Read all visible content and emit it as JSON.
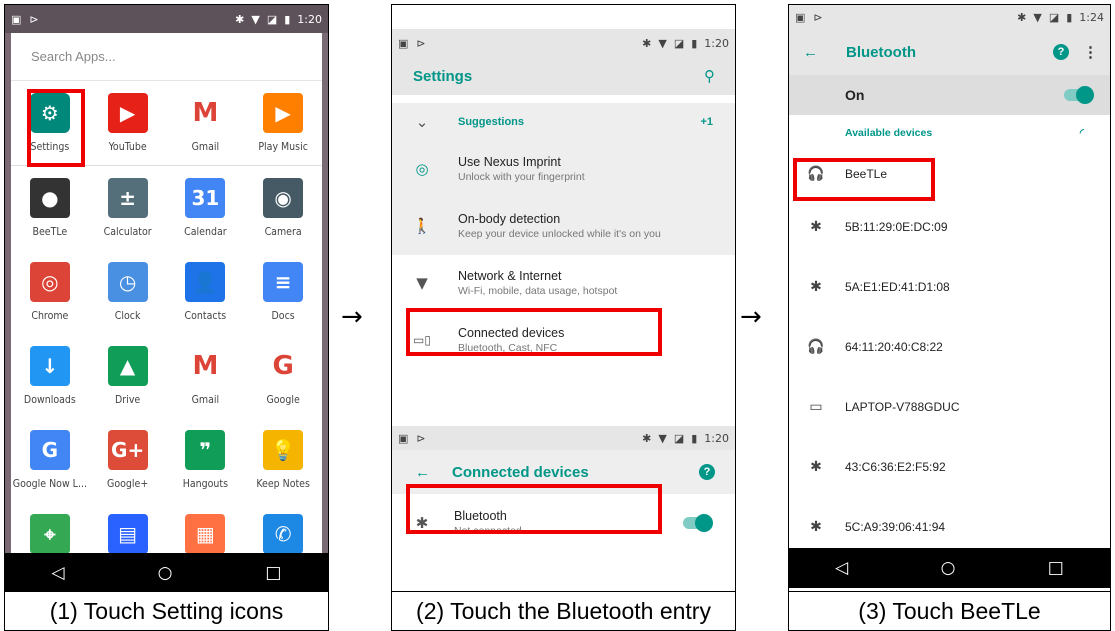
{
  "panel1": {
    "status_time": "1:20",
    "search_placeholder": "Search Apps...",
    "apps": [
      {
        "label": "Settings",
        "icon": "settings-icon",
        "glyph": "⚙",
        "color": "#00897b"
      },
      {
        "label": "YouTube",
        "icon": "youtube-icon",
        "glyph": "▶",
        "color": "#e62117"
      },
      {
        "label": "Gmail",
        "icon": "gmail-icon",
        "glyph": "M",
        "color": "#ffffff"
      },
      {
        "label": "Play Music",
        "icon": "play-music-icon",
        "glyph": "▶",
        "color": "#ff7f00"
      },
      {
        "label": "BeeTLe",
        "icon": "beetle-icon",
        "glyph": "●",
        "color": "#333333"
      },
      {
        "label": "Calculator",
        "icon": "calculator-icon",
        "glyph": "±",
        "color": "#546e7a"
      },
      {
        "label": "Calendar",
        "icon": "calendar-icon",
        "glyph": "31",
        "color": "#4285f4"
      },
      {
        "label": "Camera",
        "icon": "camera-icon",
        "glyph": "◉",
        "color": "#455a64"
      },
      {
        "label": "Chrome",
        "icon": "chrome-icon",
        "glyph": "◎",
        "color": "#db4437"
      },
      {
        "label": "Clock",
        "icon": "clock-icon",
        "glyph": "◷",
        "color": "#4a90e2"
      },
      {
        "label": "Contacts",
        "icon": "contacts-icon",
        "glyph": "👤",
        "color": "#1e73e8"
      },
      {
        "label": "Docs",
        "icon": "docs-icon",
        "glyph": "≡",
        "color": "#4285f4"
      },
      {
        "label": "Downloads",
        "icon": "downloads-icon",
        "glyph": "↓",
        "color": "#2196f3"
      },
      {
        "label": "Drive",
        "icon": "drive-icon",
        "glyph": "▲",
        "color": "#0f9d58"
      },
      {
        "label": "Gmail",
        "icon": "gmail-icon",
        "glyph": "M",
        "color": "#ffffff"
      },
      {
        "label": "Google",
        "icon": "google-icon",
        "glyph": "G",
        "color": "#ffffff"
      },
      {
        "label": "Google Now L...",
        "icon": "google-now-launcher-icon",
        "glyph": "G",
        "color": "#4285f4"
      },
      {
        "label": "Google+",
        "icon": "google-plus-icon",
        "glyph": "G+",
        "color": "#dd4b39"
      },
      {
        "label": "Hangouts",
        "icon": "hangouts-icon",
        "glyph": "❞",
        "color": "#0f9d58"
      },
      {
        "label": "Keep Notes",
        "icon": "keep-notes-icon",
        "glyph": "💡",
        "color": "#f4b400"
      },
      {
        "label": "",
        "icon": "maps-icon",
        "glyph": "⌖",
        "color": "#34a853"
      },
      {
        "label": "",
        "icon": "messages-icon",
        "glyph": "▤",
        "color": "#2962ff"
      },
      {
        "label": "",
        "icon": "news-icon",
        "glyph": "▦",
        "color": "#ff7043"
      },
      {
        "label": "",
        "icon": "phone-icon",
        "glyph": "✆",
        "color": "#1e88e5"
      }
    ],
    "caption": "(1) Touch Setting icons"
  },
  "panel2": {
    "status_time": "1:20",
    "title": "Settings",
    "items": [
      {
        "title": "Suggestions",
        "badge": "+1",
        "icon": "chevron-down-icon"
      },
      {
        "title": "Use Nexus Imprint",
        "subtitle": "Unlock with your fingerprint",
        "icon": "fingerprint-icon"
      },
      {
        "title": "On-body detection",
        "subtitle": "Keep your device unlocked while it's on you",
        "icon": "walking-person-icon"
      },
      {
        "title": "Network & Internet",
        "subtitle": "Wi-Fi, mobile, data usage, hotspot",
        "icon": "wifi-icon"
      },
      {
        "title": "Connected devices",
        "subtitle": "Bluetooth, Cast, NFC",
        "icon": "devices-icon"
      }
    ],
    "sub_status_time": "1:20",
    "sub_title": "Connected devices",
    "bluetooth": {
      "title": "Bluetooth",
      "subtitle": "Not connected"
    },
    "caption": "(2) Touch the Bluetooth entry"
  },
  "panel3": {
    "status_time": "1:24",
    "title": "Bluetooth",
    "on_label": "On",
    "available_label": "Available devices",
    "devices": [
      {
        "name": "BeeTLe",
        "icon": "headphones-icon",
        "glyph": "🎧"
      },
      {
        "name": "5B:11:29:0E:DC:09",
        "icon": "bluetooth-icon",
        "glyph": "✱"
      },
      {
        "name": "5A:E1:ED:41:D1:08",
        "icon": "bluetooth-icon",
        "glyph": "✱"
      },
      {
        "name": "64:11:20:40:C8:22",
        "icon": "headphones-icon",
        "glyph": "🎧"
      },
      {
        "name": "LAPTOP-V788GDUC",
        "icon": "laptop-icon",
        "glyph": "▭"
      },
      {
        "name": "43:C6:36:E2:F5:92",
        "icon": "bluetooth-icon",
        "glyph": "✱"
      },
      {
        "name": "5C:A9:39:06:41:94",
        "icon": "bluetooth-icon",
        "glyph": "✱"
      }
    ],
    "caption": "(3) Touch BeeTLe"
  },
  "arrow": "→"
}
